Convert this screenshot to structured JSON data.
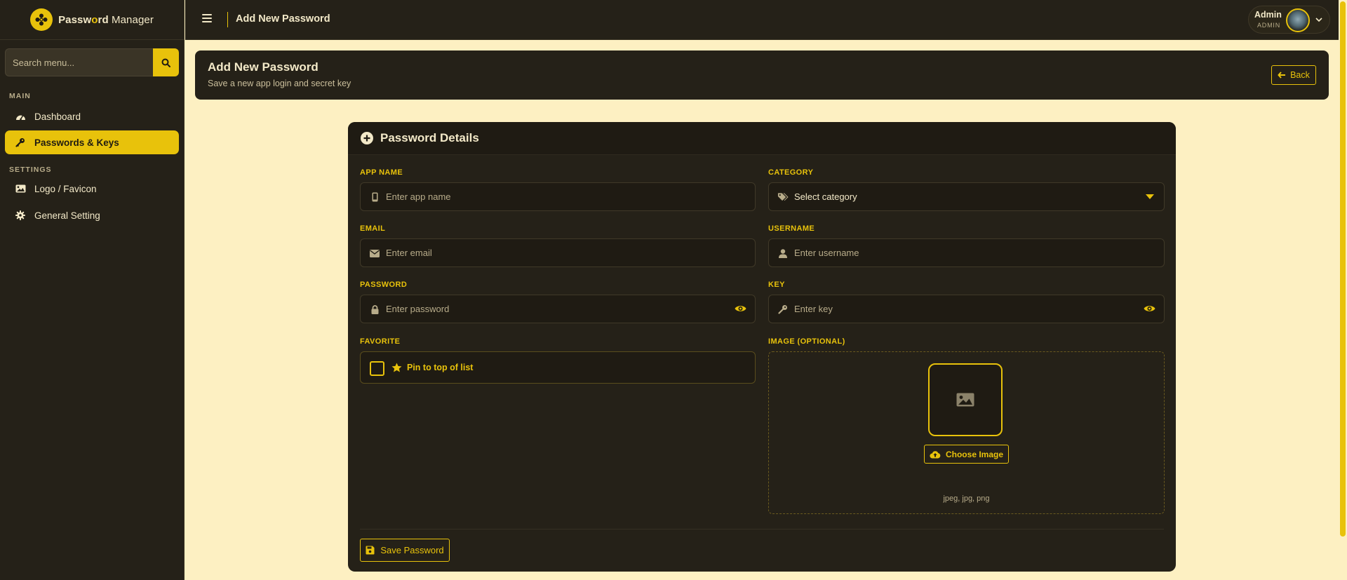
{
  "app": {
    "brand_part1": "Passw",
    "brand_accent": "o",
    "brand_part2": "rd",
    "brand_light": "Manager"
  },
  "sidebar": {
    "search_placeholder": "Search menu...",
    "sections": {
      "main": "MAIN",
      "settings": "SETTINGS"
    },
    "items": [
      {
        "label": "Dashboard",
        "icon": "gauge-icon",
        "active": false
      },
      {
        "label": "Passwords & Keys",
        "icon": "key-icon",
        "active": true
      },
      {
        "label": "Logo / Favicon",
        "icon": "image-icon",
        "active": false
      },
      {
        "label": "General Setting",
        "icon": "gear-icon",
        "active": false
      }
    ]
  },
  "topbar": {
    "title": "Add New Password",
    "user_name": "Admin",
    "user_role": "ADMIN"
  },
  "page_header": {
    "title": "Add New Password",
    "subtitle": "Save a new app login and secret key",
    "back_label": "Back"
  },
  "form": {
    "title": "Password Details",
    "fields": {
      "app_name": {
        "label": "APP NAME",
        "placeholder": "Enter app name",
        "value": ""
      },
      "category": {
        "label": "CATEGORY",
        "selected": "Select category"
      },
      "email": {
        "label": "EMAIL",
        "placeholder": "Enter email",
        "value": ""
      },
      "username": {
        "label": "USERNAME",
        "placeholder": "Enter username",
        "value": ""
      },
      "password": {
        "label": "PASSWORD",
        "placeholder": "Enter password",
        "value": ""
      },
      "key": {
        "label": "KEY",
        "placeholder": "Enter key",
        "value": ""
      }
    },
    "favorite": {
      "label": "FAVORITE",
      "checkbox_text": "Pin to top of list",
      "checked": false
    },
    "image": {
      "label": "IMAGE (OPTIONAL)",
      "button": "Choose Image",
      "hint": "jpeg, jpg, png"
    },
    "save_label": "Save Password"
  },
  "colors": {
    "accent": "#e8c20b",
    "panel": "#252118",
    "page_bg": "#fdf0c2"
  }
}
